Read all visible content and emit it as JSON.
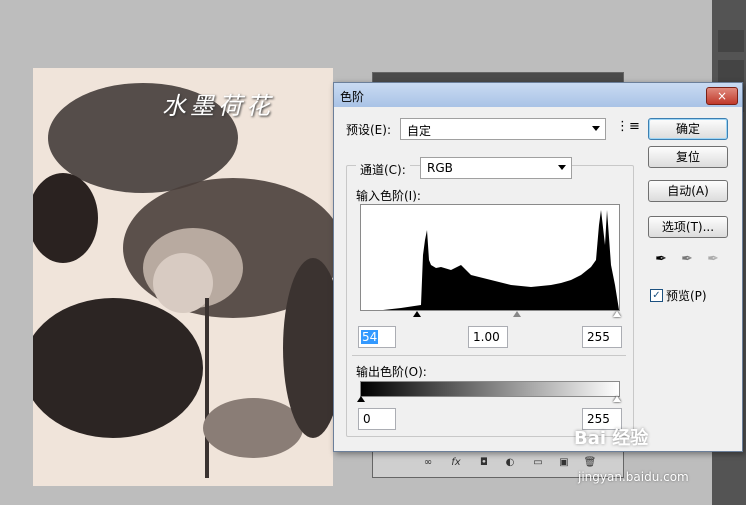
{
  "document": {
    "title_art": "水墨荷花"
  },
  "dialog": {
    "title": "色阶",
    "close_label": "×",
    "preset_label": "预设(E):",
    "preset_value": "自定",
    "channel_label": "通道(C):",
    "channel_value": "RGB",
    "input_levels_label": "输入色阶(I):",
    "input_black": "54",
    "input_gamma": "1.00",
    "input_white": "255",
    "output_levels_label": "输出色阶(O):",
    "output_black": "0",
    "output_white": "255",
    "buttons": {
      "ok": "确定",
      "reset": "复位",
      "auto": "自动(A)",
      "options": "选项(T)..."
    },
    "preview_label": "预览(P)",
    "preview_checked": true
  },
  "watermark": {
    "text": "Bai 经验",
    "url": "jingyan.baidu.com"
  },
  "icons": [
    "close-icon",
    "preset-menu-icon",
    "black-eyedropper-icon",
    "gray-eyedropper-icon",
    "white-eyedropper-icon",
    "link-icon",
    "fx-icon",
    "mask-icon",
    "adjustment-icon",
    "folder-icon",
    "new-layer-icon",
    "trash-icon"
  ]
}
